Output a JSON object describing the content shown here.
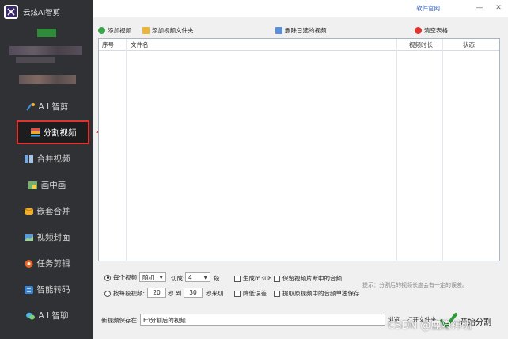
{
  "app": {
    "name": "云炫AI智剪"
  },
  "topbar": {
    "website_link": "软件官网",
    "minimize_glyph": "—",
    "close_glyph": "✕"
  },
  "sidebar": {
    "items": [
      {
        "label": "A I 智剪",
        "icon": "ai-cut-icon",
        "active": false
      },
      {
        "label": "分割视频",
        "icon": "split-video-icon",
        "active": true
      },
      {
        "label": "合并视频",
        "icon": "merge-video-icon",
        "active": false
      },
      {
        "label": "画中画",
        "icon": "picture-in-picture-icon",
        "active": false
      },
      {
        "label": "嵌套合并",
        "icon": "nested-merge-icon",
        "active": false
      },
      {
        "label": "视频封面",
        "icon": "video-cover-icon",
        "active": false
      },
      {
        "label": "任务剪辑",
        "icon": "task-edit-icon",
        "active": false
      },
      {
        "label": "智能转码",
        "icon": "smart-transcode-icon",
        "active": false
      },
      {
        "label": "A I 智聊",
        "icon": "ai-chat-icon",
        "active": false
      }
    ]
  },
  "toolbar": {
    "add_video": "添加视频",
    "add_folder": "添加视频文件夹",
    "delete_selected": "删除已选的视频",
    "clear_table": "清空表格"
  },
  "table": {
    "columns": [
      "序号",
      "文件名",
      "视频时长",
      "状态"
    ],
    "rows": []
  },
  "options": {
    "per_video_label": "每个视频",
    "mode_value": "随机",
    "cut_label": "切成:",
    "cut_count": "4",
    "segment_unit": "段",
    "by_segment_label": "按每段视频:",
    "min_seconds": "20",
    "seconds_to": "秒 到",
    "max_seconds": "30",
    "seconds_cut": "秒来切",
    "gen_m3u8": "生成m3u8",
    "reduce_error": "降低误差",
    "keep_audio": "保留视频片断中的音频",
    "extract_audio": "提取原视频中的音频单独保存",
    "hint": "提示：分割后的视频长度会有一定的误差。"
  },
  "bottom": {
    "save_label": "新视频保存在:",
    "save_path": "F:\\分割后的视频",
    "browse": "浏览",
    "open_folder": "打开文件夹",
    "start": "开始分割"
  },
  "watermark": "CSDN @鹿隐神明",
  "colors": {
    "sidebar_bg": "#2f3134",
    "accent_red": "#e0322e",
    "link_blue": "#2d59b5"
  }
}
